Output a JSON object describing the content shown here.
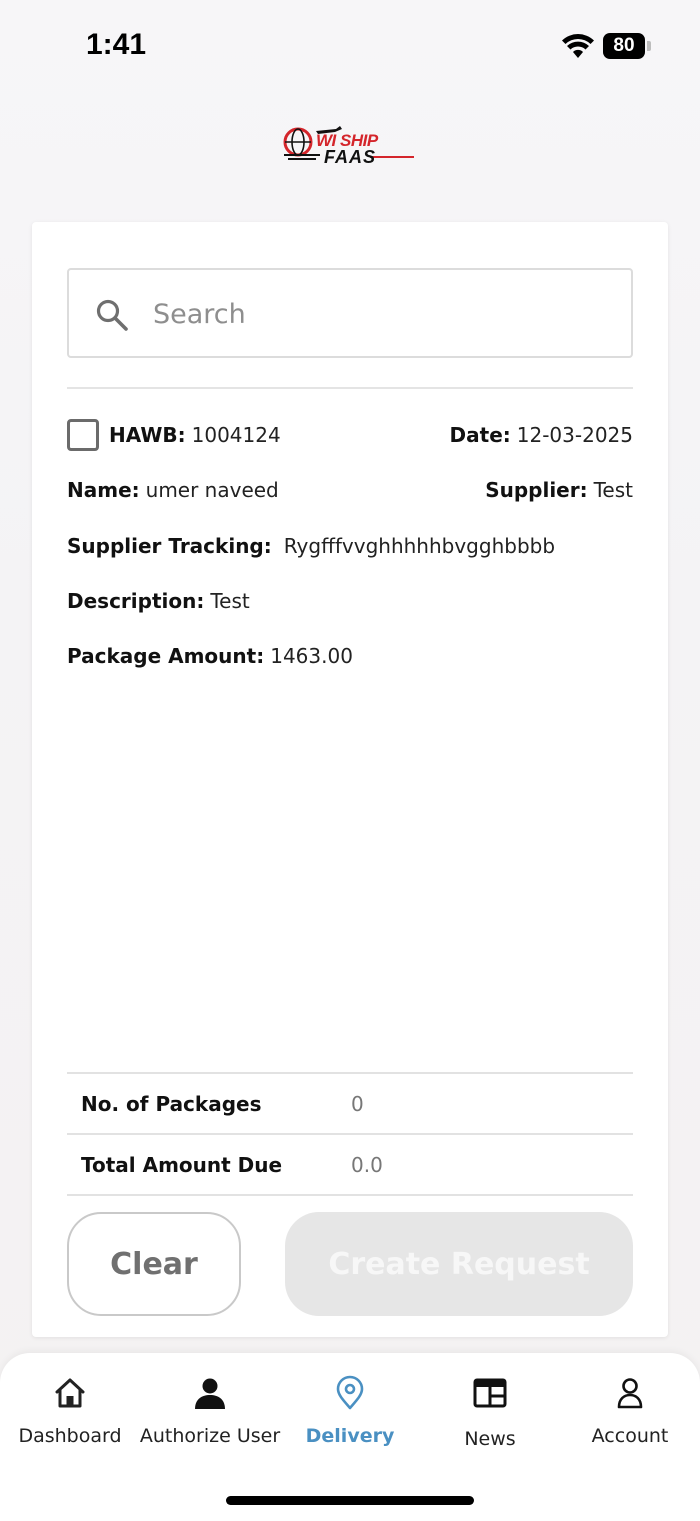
{
  "status_bar": {
    "time": "1:41",
    "battery": "80"
  },
  "logo": {
    "line1": "WI SHIP",
    "line2": "FAAS"
  },
  "search": {
    "placeholder": "Search"
  },
  "record": {
    "hawb_label": "HAWB:",
    "hawb_value": "1004124",
    "date_label": "Date:",
    "date_value": "12-03-2025",
    "name_label": "Name:",
    "name_value": "umer naveed",
    "supplier_label": "Supplier:",
    "supplier_value": "Test",
    "tracking_label": "Supplier Tracking:",
    "tracking_value": "Rygfffvvghhhhhbvgghbbbb",
    "description_label": "Description:",
    "description_value": "Test",
    "amount_label": "Package Amount:",
    "amount_value": "1463.00",
    "checked": false
  },
  "summary": {
    "packages_label": "No. of Packages",
    "packages_value": "0",
    "total_label": "Total Amount Due",
    "total_value": "0.0"
  },
  "buttons": {
    "clear": "Clear",
    "create": "Create Request"
  },
  "nav": {
    "items": [
      {
        "label": "Dashboard",
        "icon": "home-icon"
      },
      {
        "label": "Authorize User",
        "icon": "user-icon"
      },
      {
        "label": "Delivery",
        "icon": "location-pin-icon"
      },
      {
        "label": "News",
        "icon": "news-icon"
      },
      {
        "label": "Account",
        "icon": "account-icon"
      }
    ],
    "active": "Delivery"
  },
  "colors": {
    "accent": "#4a90c2",
    "logo_red": "#d4252b",
    "disabled_button": "#e6e6e6"
  }
}
